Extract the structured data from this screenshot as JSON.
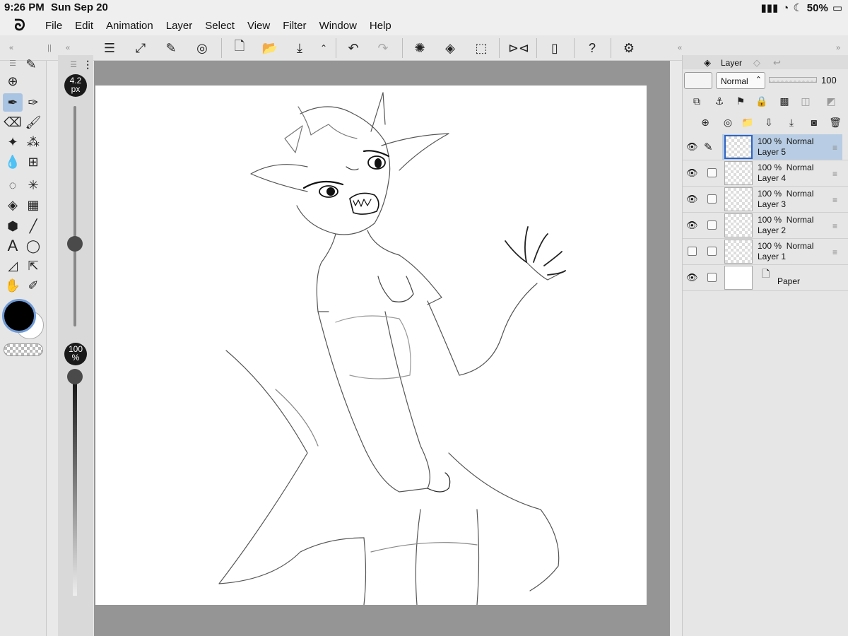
{
  "status": {
    "time": "9:26 PM",
    "date": "Sun Sep 20",
    "battery": "50%"
  },
  "menu": {
    "logo_icon": "clip-studio-icon",
    "items": [
      "File",
      "Edit",
      "Animation",
      "Layer",
      "Select",
      "View",
      "Filter",
      "Window",
      "Help"
    ]
  },
  "sliders": {
    "brush_size": "4.2",
    "brush_size_unit": "px",
    "opacity": "100",
    "opacity_unit": "%"
  },
  "layer_panel": {
    "tab_label": "Layer",
    "blend_mode": "Normal",
    "opacity": "100",
    "layers": [
      {
        "opacity": "100 %",
        "mode": "Normal",
        "name": "Layer 5",
        "visible": true,
        "selected": true
      },
      {
        "opacity": "100 %",
        "mode": "Normal",
        "name": "Layer 4",
        "visible": true,
        "selected": false
      },
      {
        "opacity": "100 %",
        "mode": "Normal",
        "name": "Layer 3",
        "visible": true,
        "selected": false
      },
      {
        "opacity": "100 %",
        "mode": "Normal",
        "name": "Layer 2",
        "visible": true,
        "selected": false
      },
      {
        "opacity": "100 %",
        "mode": "Normal",
        "name": "Layer 1",
        "visible": false,
        "selected": false
      },
      {
        "opacity": "",
        "mode": "",
        "name": "Paper",
        "visible": true,
        "selected": false
      }
    ]
  },
  "colors": {
    "main": "#000000",
    "sub": "#ffffff",
    "selected_tool_bg": "#a9c4e2",
    "selected_layer_bg": "#b8cde3"
  }
}
